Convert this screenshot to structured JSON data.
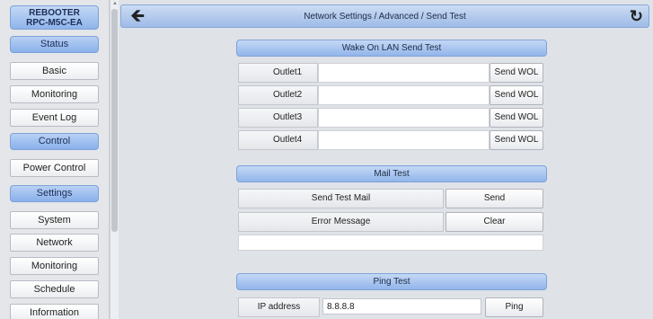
{
  "sidebar": {
    "brand_line1": "REBOOTER",
    "brand_line2": "RPC-M5C-EA",
    "status_section": "Status",
    "status_items": [
      "Basic",
      "Monitoring",
      "Event Log"
    ],
    "control_section": "Control",
    "control_items": [
      "Power Control"
    ],
    "settings_section": "Settings",
    "settings_items": [
      "System",
      "Network",
      "Monitoring",
      "Schedule",
      "Information"
    ]
  },
  "header": {
    "title": "Network Settings / Advanced / Send Test",
    "back_icon": "arrow-left-icon",
    "refresh_icon": "refresh-icon"
  },
  "wol": {
    "title": "Wake On LAN Send Test",
    "rows": [
      {
        "label": "Outlet1",
        "value": "",
        "button": "Send WOL"
      },
      {
        "label": "Outlet2",
        "value": "",
        "button": "Send WOL"
      },
      {
        "label": "Outlet3",
        "value": "",
        "button": "Send WOL"
      },
      {
        "label": "Outlet4",
        "value": "",
        "button": "Send WOL"
      }
    ]
  },
  "mail": {
    "title": "Mail Test",
    "send_label": "Send Test Mail",
    "send_button": "Send",
    "error_label": "Error Message",
    "clear_button": "Clear",
    "error_text": ""
  },
  "ping": {
    "title": "Ping Test",
    "ip_label": "IP address",
    "ip_value": "8.8.8.8",
    "ping_button": "Ping"
  },
  "colors": {
    "section_blue": "#8ab0ea",
    "background": "#dfe3e8"
  }
}
